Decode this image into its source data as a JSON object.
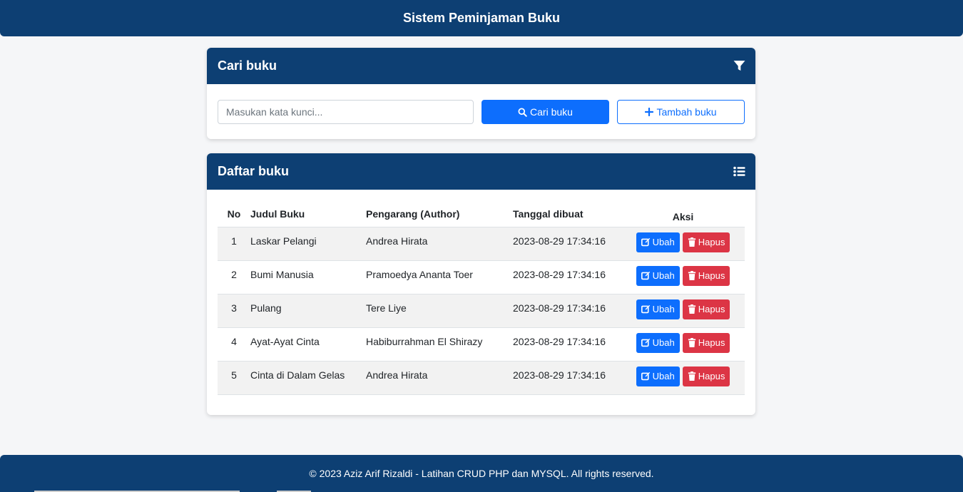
{
  "app": {
    "title": "Sistem Peminjaman Buku"
  },
  "search": {
    "header": "Cari buku",
    "filter_icon": "filter-icon",
    "placeholder": "Masukan kata kunci...",
    "value": "",
    "search_button": "Cari buku",
    "add_button": "Tambah buku"
  },
  "list": {
    "header": "Daftar buku",
    "list_icon": "list-icon",
    "columns": {
      "no": "No",
      "judul": "Judul Buku",
      "pengarang": "Pengarang (Author)",
      "tanggal": "Tanggal dibuat",
      "aksi": "Aksi"
    },
    "edit_label": "Ubah",
    "delete_label": "Hapus",
    "rows": [
      {
        "no": "1",
        "judul": "Laskar Pelangi",
        "pengarang": "Andrea Hirata",
        "tanggal": "2023-08-29 17:34:16"
      },
      {
        "no": "2",
        "judul": "Bumi Manusia",
        "pengarang": "Pramoedya Ananta Toer",
        "tanggal": "2023-08-29 17:34:16"
      },
      {
        "no": "3",
        "judul": "Pulang",
        "pengarang": "Tere Liye",
        "tanggal": "2023-08-29 17:34:16"
      },
      {
        "no": "4",
        "judul": "Ayat-Ayat Cinta",
        "pengarang": "Habiburrahman El Shirazy",
        "tanggal": "2023-08-29 17:34:16"
      },
      {
        "no": "5",
        "judul": "Cinta di Dalam Gelas",
        "pengarang": "Andrea Hirata",
        "tanggal": "2023-08-29 17:34:16"
      }
    ]
  },
  "footer": {
    "text": "© 2023 Aziz Arif Rizaldi - Latihan CRUD PHP dan MYSQL. All rights reserved."
  },
  "colors": {
    "primary_dark": "#0d3f73",
    "primary": "#0d6efd",
    "danger": "#dc3545"
  }
}
